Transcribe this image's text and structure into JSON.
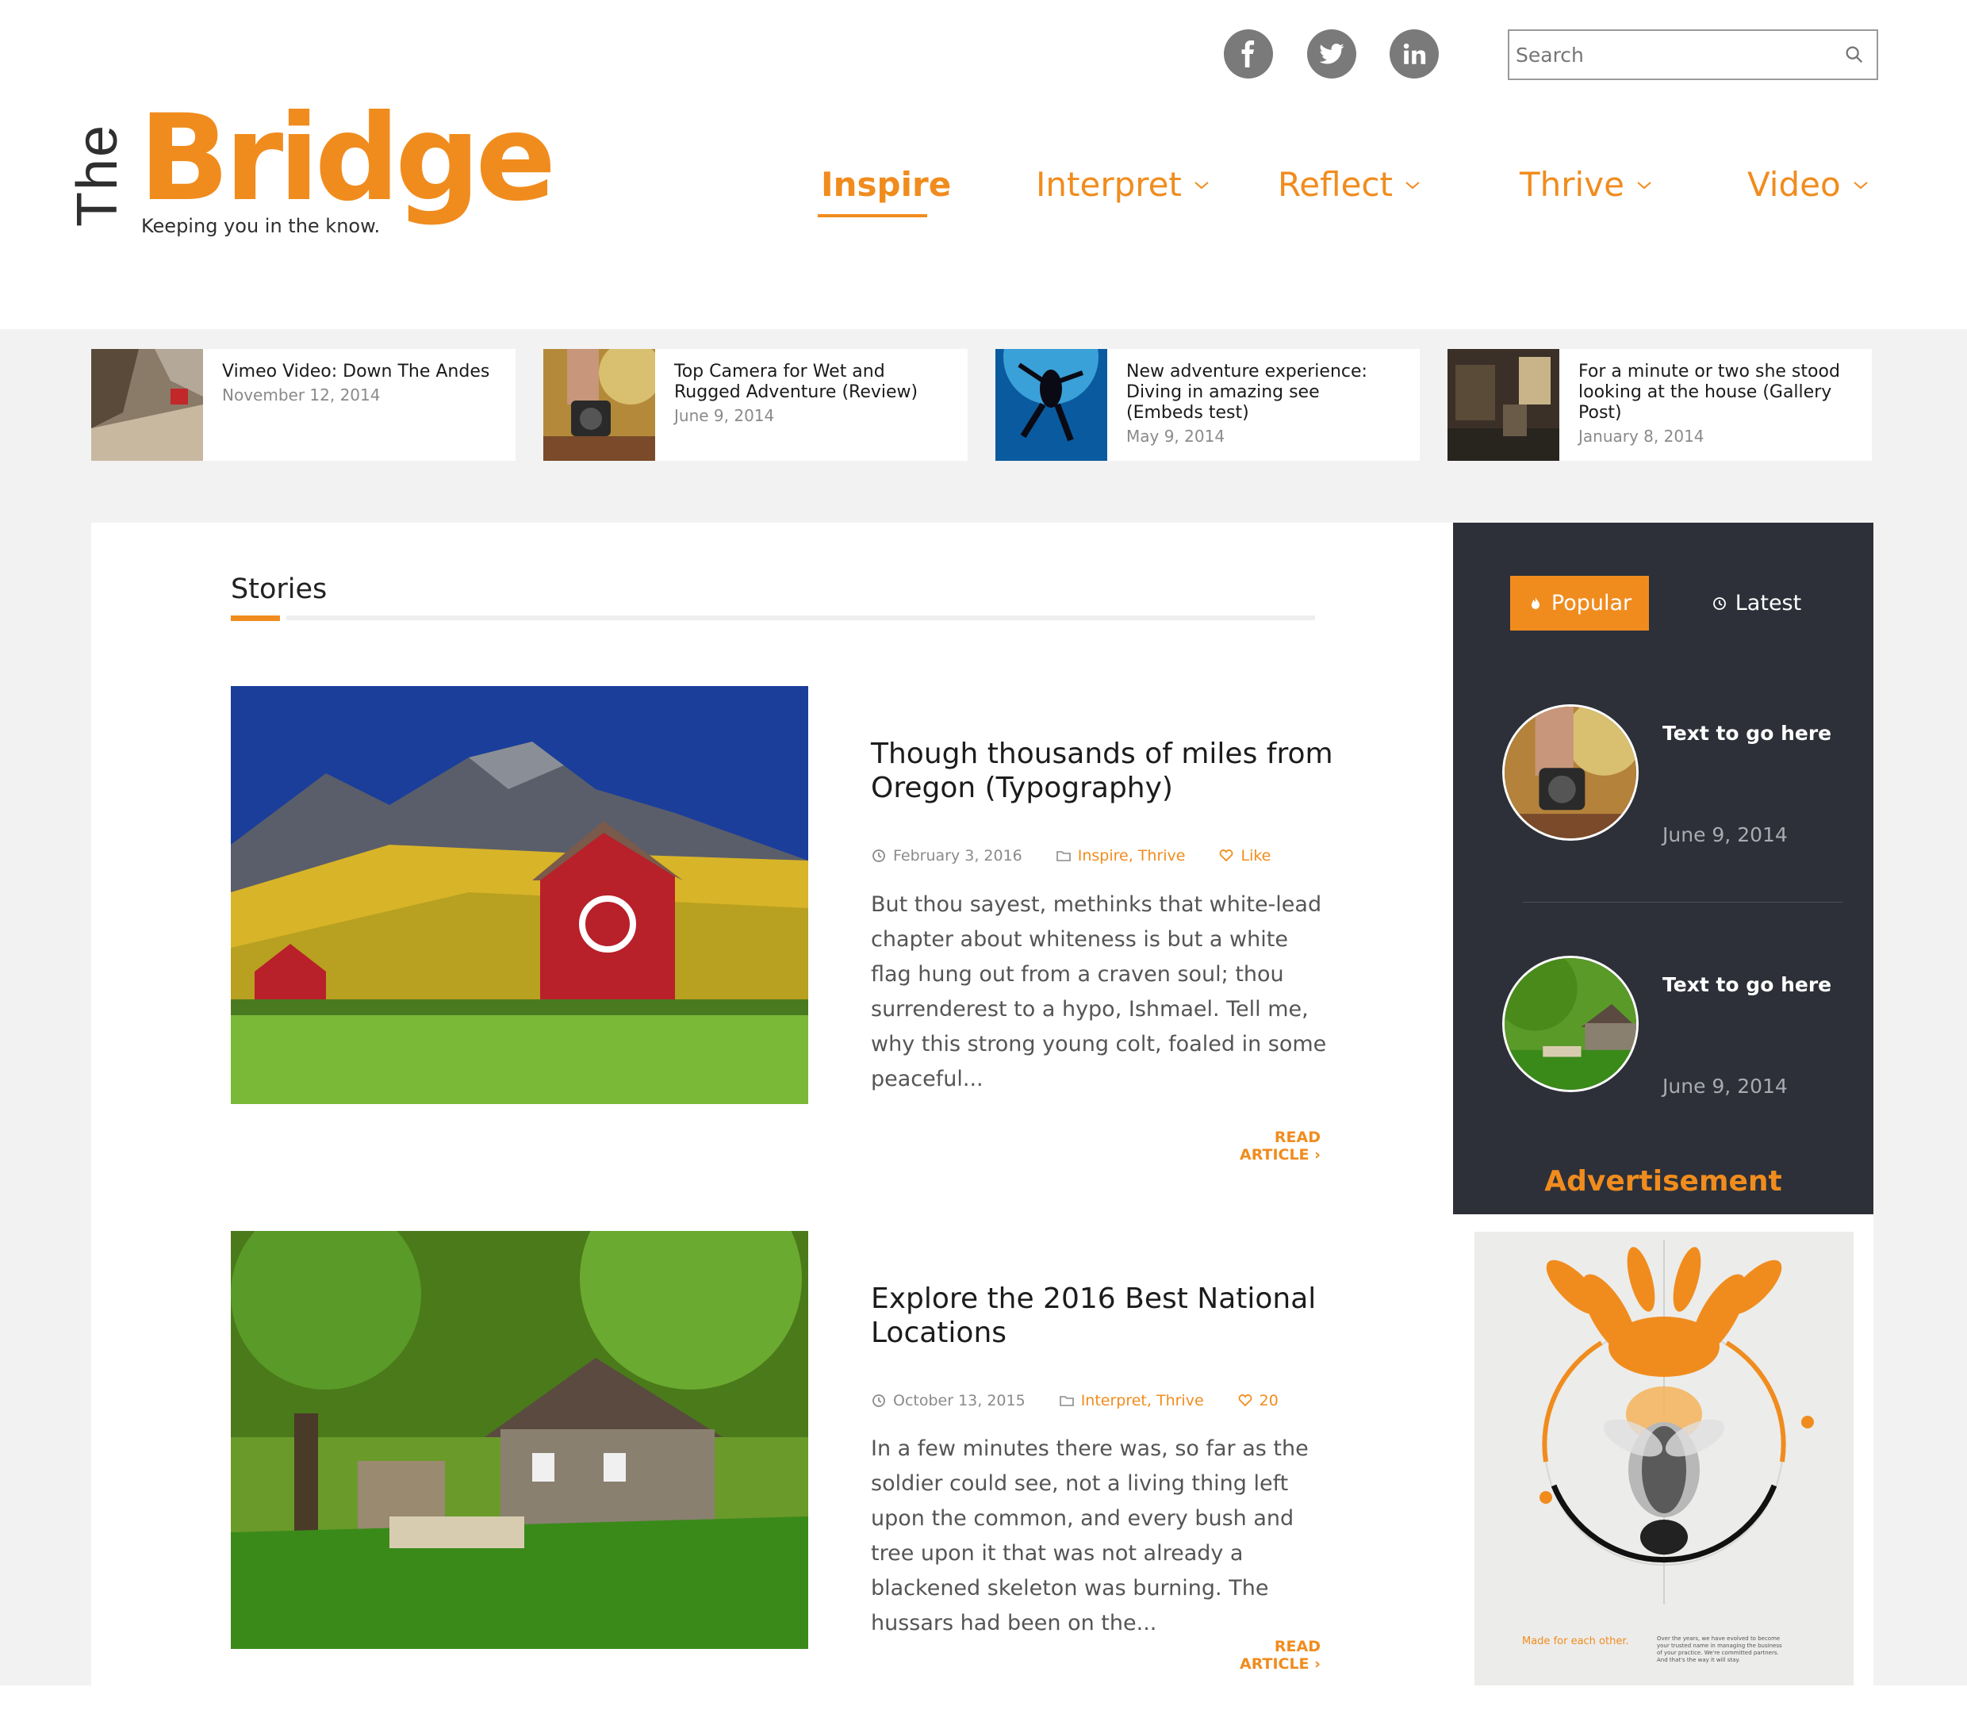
{
  "header": {
    "social": [
      {
        "icon": "facebook-icon"
      },
      {
        "icon": "twitter-icon"
      },
      {
        "icon": "linkedin-icon"
      }
    ],
    "search": {
      "placeholder": "Search"
    },
    "logo": {
      "the": "The",
      "bridge": "Bridge",
      "tagline": "Keeping you in the know."
    },
    "nav": [
      {
        "label": "Inspire",
        "active": true
      },
      {
        "label": "Interpret",
        "dropdown": true
      },
      {
        "label": "Reflect",
        "dropdown": true
      },
      {
        "label": "Thrive",
        "dropdown": true
      },
      {
        "label": "Video",
        "dropdown": true
      }
    ]
  },
  "featured": [
    {
      "title": "Vimeo Video: Down The Andes",
      "date": "November 12, 2014"
    },
    {
      "title": "Top Camera for Wet and Rugged Adventure (Review)",
      "date": "June 9, 2014"
    },
    {
      "title": "New adventure experience: Diving in amazing see (Embeds test)",
      "date": "May 9, 2014"
    },
    {
      "title": "For a minute or two she stood looking at the house (Gallery Post)",
      "date": "January 8, 2014"
    }
  ],
  "stories": {
    "heading": "Stories",
    "articles": [
      {
        "title": "Though thousands of miles from Oregon (Typography)",
        "date": "February 3, 2016",
        "categories": "Inspire, Thrive",
        "like": "Like",
        "excerpt": "But thou sayest, methinks that white-lead chapter about whiteness is but a white flag hung out from a craven soul; thou surrenderest to a hypo, Ishmael. Tell me, why this strong young colt, foaled in some peaceful...",
        "read_more": "READ ARTICLE"
      },
      {
        "title": "Explore the 2016 Best National Locations",
        "date": "October 13, 2015",
        "categories": "Interpret, Thrive",
        "like": "20",
        "excerpt": "In a few minutes there was, so far as the soldier could see, not a living thing left upon the common, and every bush and tree upon it that was not already a blackened skeleton was burning. The hussars had been on the...",
        "read_more": "READ ARTICLE"
      }
    ]
  },
  "sidebar": {
    "tabs": {
      "popular": "Popular",
      "latest": "Latest"
    },
    "items": [
      {
        "title": "Text to go here",
        "date": "June 9, 2014"
      },
      {
        "title": "Text to go here",
        "date": "June 9, 2014"
      }
    ],
    "ad_label": "Advertisement",
    "ad": {
      "headline": "Made for each other.",
      "body": "Over the years, we have evolved to become your trusted name in managing the business of your practice. We're committed partners. And that's the way it will stay."
    }
  },
  "colors": {
    "accent": "#f08c1e",
    "sidebar_bg": "#2d3038",
    "band_bg": "#f2f2f2"
  }
}
